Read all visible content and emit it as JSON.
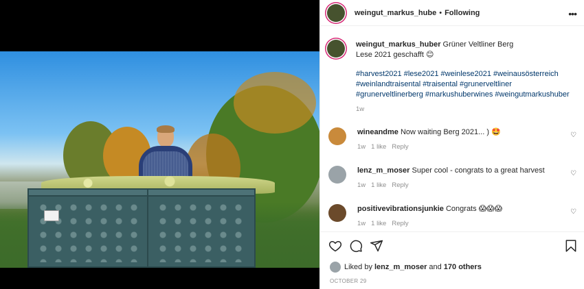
{
  "header": {
    "username": "weingut_markus_hube",
    "separator": "•",
    "follow_label": "Following",
    "more_label": "•••"
  },
  "caption": {
    "username": "weingut_markus_huber",
    "text_line1": "Grüner Veltliner Berg",
    "text_line2": "Lese 2021 geschafft",
    "emoji": "😊",
    "hashtags": "#harvest2021 #lese2021 #weinlese2021 #weinausösterreich #weinlandtraisental #traisental #grunerveltliner #grunerveltlinerberg #markushuberwines #weingutmarkushuber",
    "age": "1w"
  },
  "comments": [
    {
      "username": "wineandme",
      "text": "Now waiting Berg 2021... )",
      "emoji": "🤩",
      "age": "1w",
      "likes": "1 like",
      "reply": "Reply",
      "avatar_color": "#c98a3b"
    },
    {
      "username": "lenz_m_moser",
      "text": "Super cool - congrats to a great harvest",
      "emoji": "",
      "age": "1w",
      "likes": "1 like",
      "reply": "Reply",
      "avatar_color": "#9aa3a8"
    },
    {
      "username": "positivevibrationsjunkie",
      "text": "Congrats",
      "emoji": "😱😱😱",
      "age": "1w",
      "likes": "1 like",
      "reply": "Reply",
      "avatar_color": "#6b4a2b"
    }
  ],
  "likes": {
    "prefix": "Liked by",
    "user": "lenz_m_moser",
    "and": "and",
    "others": "170 others"
  },
  "date": "OCTOBER 29",
  "icons": {
    "like": "heart-icon",
    "comment": "comment-icon",
    "share": "share-icon",
    "save": "bookmark-icon"
  },
  "colors": {
    "link": "#00376b",
    "meta": "#8e8e8e",
    "story_ring": "#d62976"
  }
}
